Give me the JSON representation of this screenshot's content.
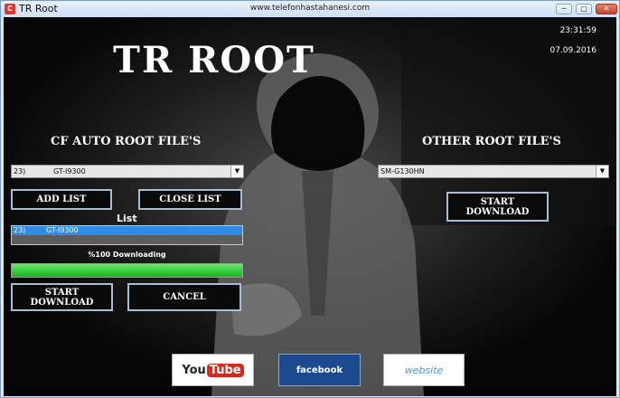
{
  "window": {
    "title": "TR Root",
    "url": "www.telefonhastahanesi.com",
    "minimize_glyph": "─",
    "maximize_glyph": "□",
    "close_glyph": "✕",
    "app_icon": "C"
  },
  "header": {
    "title": "TR ROOT",
    "time": "23:31:59",
    "date": "07.09.2016"
  },
  "cf_auto": {
    "heading": "CF AUTO ROOT FILE'S",
    "selected_num": "23)",
    "selected_value": "GT-I9300",
    "add_list": "ADD LIST",
    "close_list": "CLOSE LIST",
    "list_label": "List",
    "list_items": [
      {
        "num": "23)",
        "value": "GT-I9300"
      }
    ],
    "status": "%100 Downloading",
    "progress_percent": 100,
    "start_download": "START\nDOWNLOAD",
    "cancel": "CANCEL"
  },
  "other": {
    "heading": "OTHER ROOT FILE'S",
    "selected_value": "SM-G130HN",
    "start_download": "START\nDOWNLOAD"
  },
  "social": {
    "youtube_you": "You",
    "youtube_tube": "Tube",
    "facebook": "facebook",
    "website": "website"
  },
  "colors": {
    "accent_border": "#a6bfd6",
    "progress": "#10b81c",
    "list_selection": "#2f8ce6"
  }
}
